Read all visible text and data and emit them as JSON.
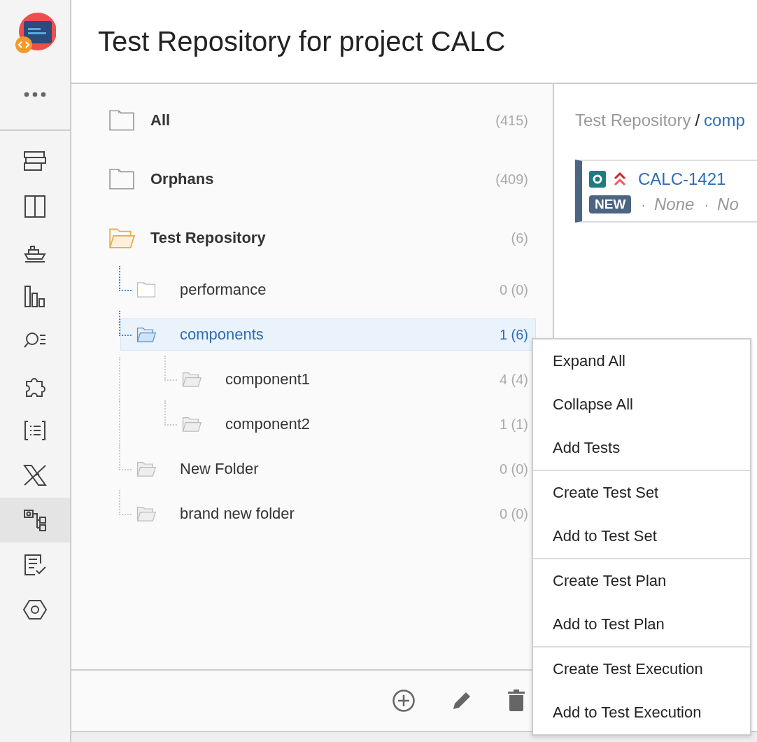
{
  "header": {
    "title": "Test Repository for project CALC"
  },
  "rail": [
    {
      "kind": "layers",
      "selected": false
    },
    {
      "kind": "columns",
      "selected": false
    },
    {
      "kind": "ship",
      "selected": false
    },
    {
      "kind": "bars",
      "selected": false
    },
    {
      "kind": "search-list",
      "selected": false
    },
    {
      "kind": "puzzle",
      "selected": false
    },
    {
      "kind": "bracket-list",
      "selected": false
    },
    {
      "kind": "x-mark",
      "selected": false
    },
    {
      "kind": "tree",
      "selected": true
    },
    {
      "kind": "checklist",
      "selected": false
    },
    {
      "kind": "hexagon",
      "selected": false
    }
  ],
  "tree": [
    {
      "label": "All",
      "count": "(415)",
      "kind": "closed",
      "selected": false
    },
    {
      "label": "Orphans",
      "count": "(409)",
      "kind": "closed",
      "selected": false
    },
    {
      "label": "Test Repository",
      "count": "(6)",
      "kind": "open",
      "selected": false,
      "children": [
        {
          "label": "performance",
          "count": "0 (0)",
          "kind": "closed",
          "selected": false
        },
        {
          "label": "components",
          "count": "1 (6)",
          "kind": "open",
          "selected": true,
          "children": [
            {
              "label": "component1",
              "count": "4 (4)",
              "kind": "open",
              "selected": false
            },
            {
              "label": "component2",
              "count": "1 (1)",
              "kind": "open",
              "selected": false
            }
          ]
        },
        {
          "label": "New Folder",
          "count": "0 (0)",
          "kind": "open",
          "selected": false
        },
        {
          "label": "brand new folder",
          "count": "0 (0)",
          "kind": "open",
          "selected": false
        }
      ]
    }
  ],
  "breadcrumb": {
    "root": "Test Repository",
    "separator": "/",
    "current": "comp"
  },
  "test_card": {
    "key": "CALC-1421",
    "status": "NEW",
    "meta": [
      {
        "sep": "·",
        "text": "None"
      },
      {
        "sep": "·",
        "text": "No"
      }
    ]
  },
  "context_menu": [
    [
      "Expand All",
      "Collapse All",
      "Add Tests"
    ],
    [
      "Create Test Set",
      "Add to Test Set"
    ],
    [
      "Create Test Plan",
      "Add to Test Plan"
    ],
    [
      "Create Test Execution",
      "Add to Test Execution"
    ]
  ]
}
